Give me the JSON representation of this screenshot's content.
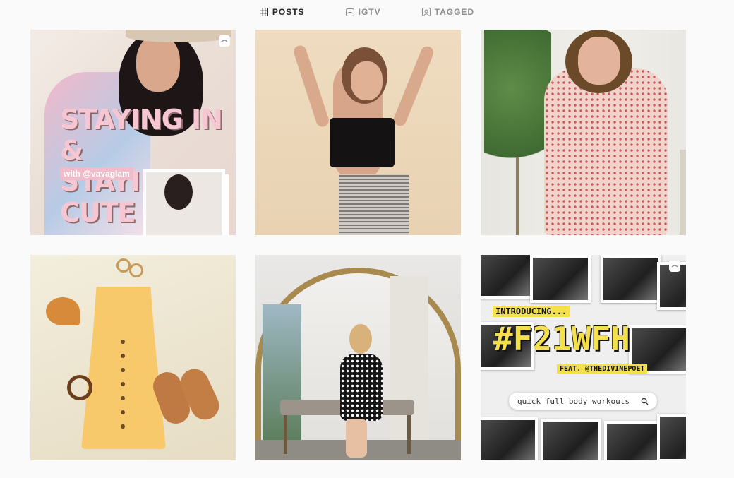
{
  "tabs": [
    {
      "label": "POSTS",
      "icon": "grid-icon",
      "active": true
    },
    {
      "label": "IGTV",
      "icon": "igtv-icon",
      "active": false
    },
    {
      "label": "TAGGED",
      "icon": "tagged-icon",
      "active": false
    }
  ],
  "posts": [
    {
      "type": "igtv",
      "title_line1": "STAYING IN &",
      "title_line2": "STAYING CUTE",
      "subtitle": "with @vavaglam",
      "badge_icon": "igtv-badge-icon"
    },
    {
      "type": "photo"
    },
    {
      "type": "photo"
    },
    {
      "type": "photo"
    },
    {
      "type": "photo"
    },
    {
      "type": "igtv",
      "intro": "INTRODUCING...",
      "hashtag": "#F21WFH",
      "feat": "FEAT. @THEDIVINEPOET",
      "search_text": "quick full body workouts",
      "badge_icon": "igtv-badge-icon"
    }
  ],
  "colors": {
    "background": "#fafafa",
    "tab_active": "#262626",
    "tab_inactive": "#8e8e8e",
    "highlight_yellow": "#f4e04d",
    "title_pink": "#f6c7d2"
  }
}
